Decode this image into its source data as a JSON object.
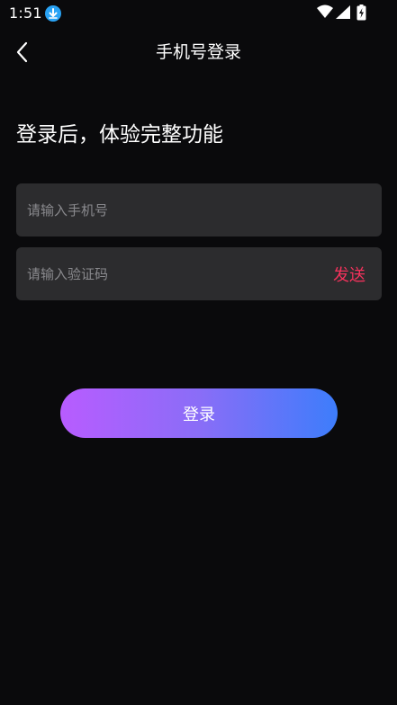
{
  "status_bar": {
    "time": "1:51"
  },
  "header": {
    "title": "手机号登录"
  },
  "headline": "登录后，体验完整功能",
  "form": {
    "phone_placeholder": "请输入手机号",
    "phone_value": "",
    "code_placeholder": "请输入验证码",
    "code_value": "",
    "send_label": "发送"
  },
  "login_button": {
    "label": "登录"
  },
  "colors": {
    "background": "#0a0a0c",
    "field_background": "#2c2c2e",
    "send_accent": "#f5325c",
    "gradient_start": "#b85cff",
    "gradient_end": "#3d7dfb",
    "download_badge": "#29a3f5"
  },
  "icons": {
    "status_download": "download-icon",
    "status_wifi": "wifi-icon",
    "status_signal": "signal-icon",
    "status_battery": "battery-icon",
    "back": "chevron-left-icon"
  }
}
